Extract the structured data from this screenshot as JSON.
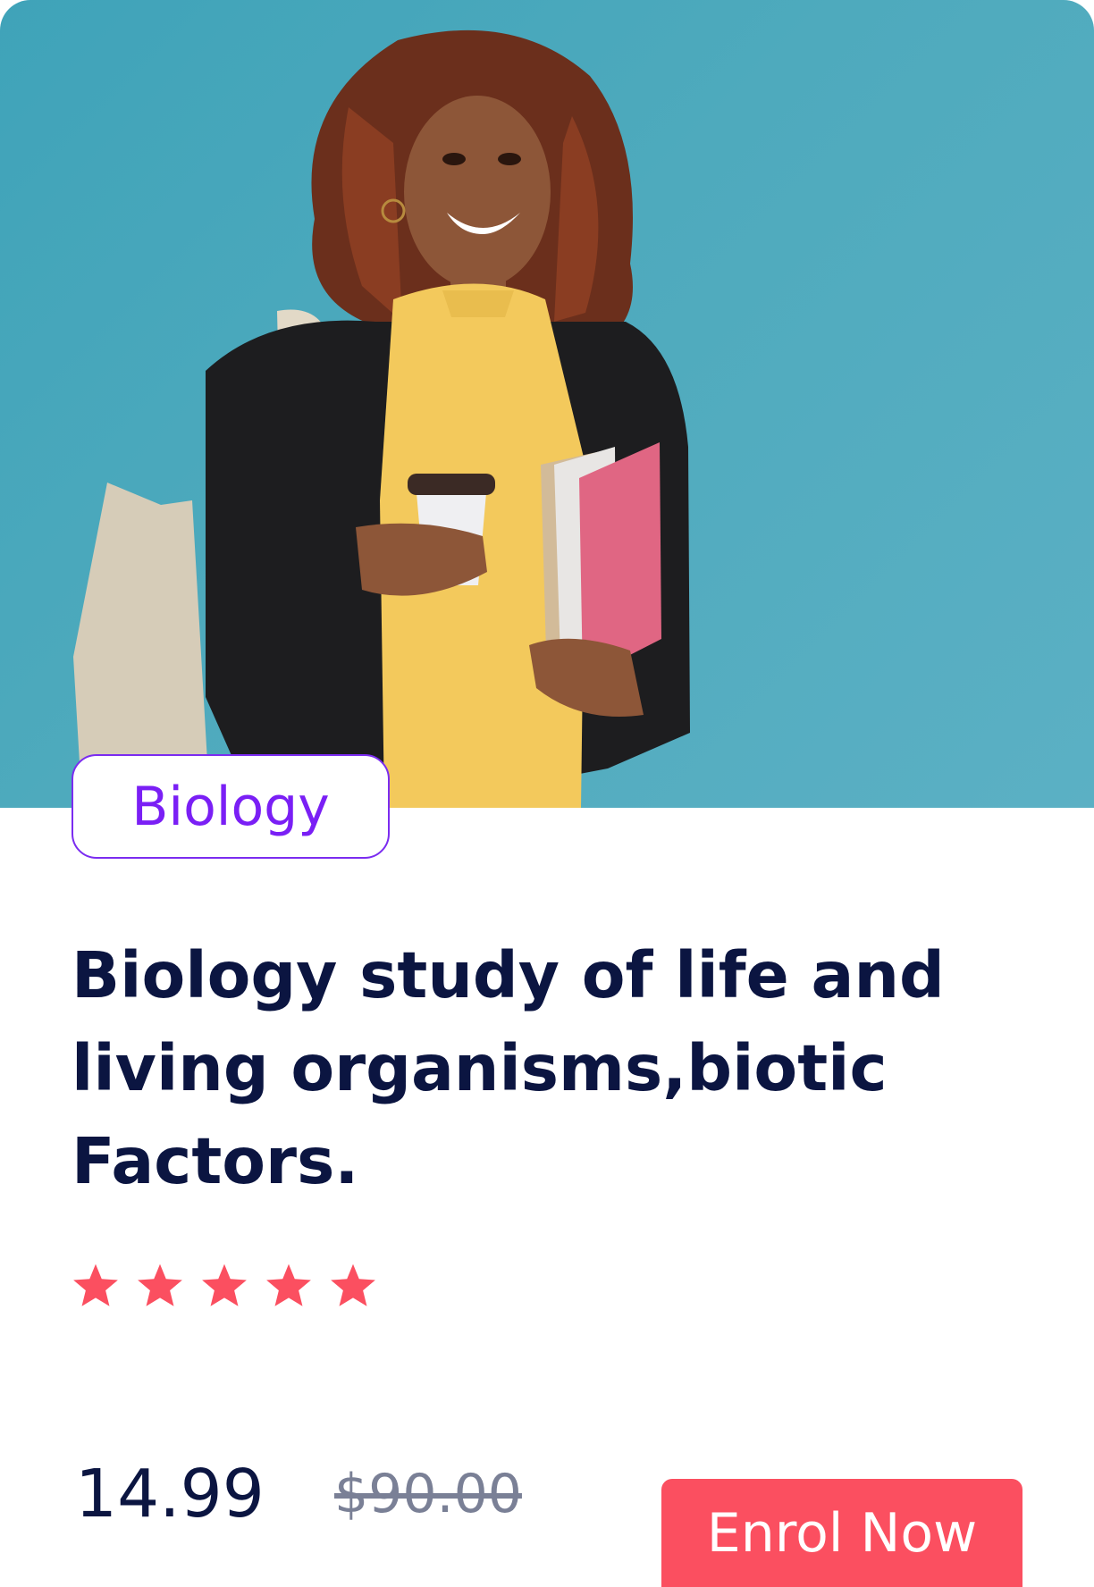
{
  "course": {
    "category": "Biology",
    "title": "Biology study of life and living organisms,biotic Factors.",
    "rating_stars": 5,
    "price": "14.99",
    "original_price": "$90.00",
    "enrol_label": "Enrol Now"
  },
  "colors": {
    "hero_background": "#4eaabd",
    "category_accent": "#7a1ff5",
    "title": "#0b1541",
    "star": "#fb4f60",
    "button": "#fb4f60",
    "old_price": "#7a8096"
  }
}
